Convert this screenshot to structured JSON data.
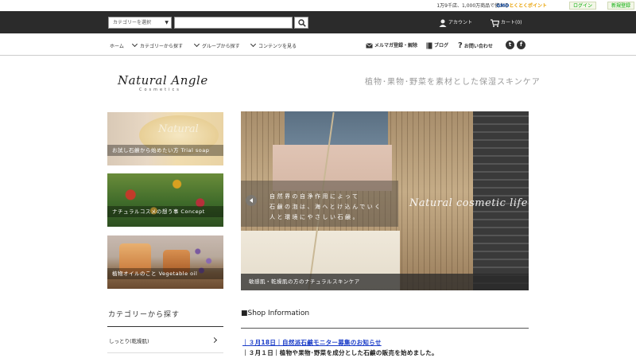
{
  "topbar": {
    "promo": "1万9千店、1,000万商品で使える",
    "gmo_logo": "GMO",
    "gmo_logo_suffix": "とくとくポイント",
    "login": "ログイン",
    "register": "新規登録"
  },
  "header": {
    "category_select": "カテゴリーを選択",
    "search_value": "",
    "account": "アカウント",
    "cart": "カート(0)"
  },
  "nav": {
    "items": [
      "ホーム",
      "カテゴリーから探す",
      "グループから探す",
      "コンテンツを見る"
    ],
    "newsletter": "メルマガ登録・解除",
    "blog": "ブログ",
    "contact": "お問い合わせ",
    "social": [
      "twitter-icon",
      "facebook-icon"
    ]
  },
  "brand": {
    "logo": "Natural Angle",
    "logo_sub": "Cosmetics",
    "tagline": "植物･果物･野菜を素材とした保湿スキンケア"
  },
  "thumbs": [
    {
      "caption": "お試し石鹸から始めたい方  Trial soap",
      "art_text": "Natural"
    },
    {
      "caption": "ナチュラルコスメの想う事  Concept"
    },
    {
      "caption": "植物オイルのこと  Vegetable oil"
    }
  ],
  "hero": {
    "line1": "自然界の自浄作用によって",
    "line2": "石鹸の泡は、海へとけ込んでいく",
    "line3": "人と環境にやさしい石鹸。",
    "script": "Natural cosmetic life",
    "caption": "敏感肌・乾燥肌の方のナチュラルスキンケア"
  },
  "category": {
    "heading": "カテゴリーから探す",
    "items": [
      "しっとり(乾燥肌)"
    ]
  },
  "shop": {
    "heading": "■Shop Information",
    "news": [
      "｜３月18日｜自然派石鹸モニター募集のお知らせ",
      "｜３月１日｜植物や果物･野菜を成分とした石鹸の販売を始めました。"
    ]
  }
}
